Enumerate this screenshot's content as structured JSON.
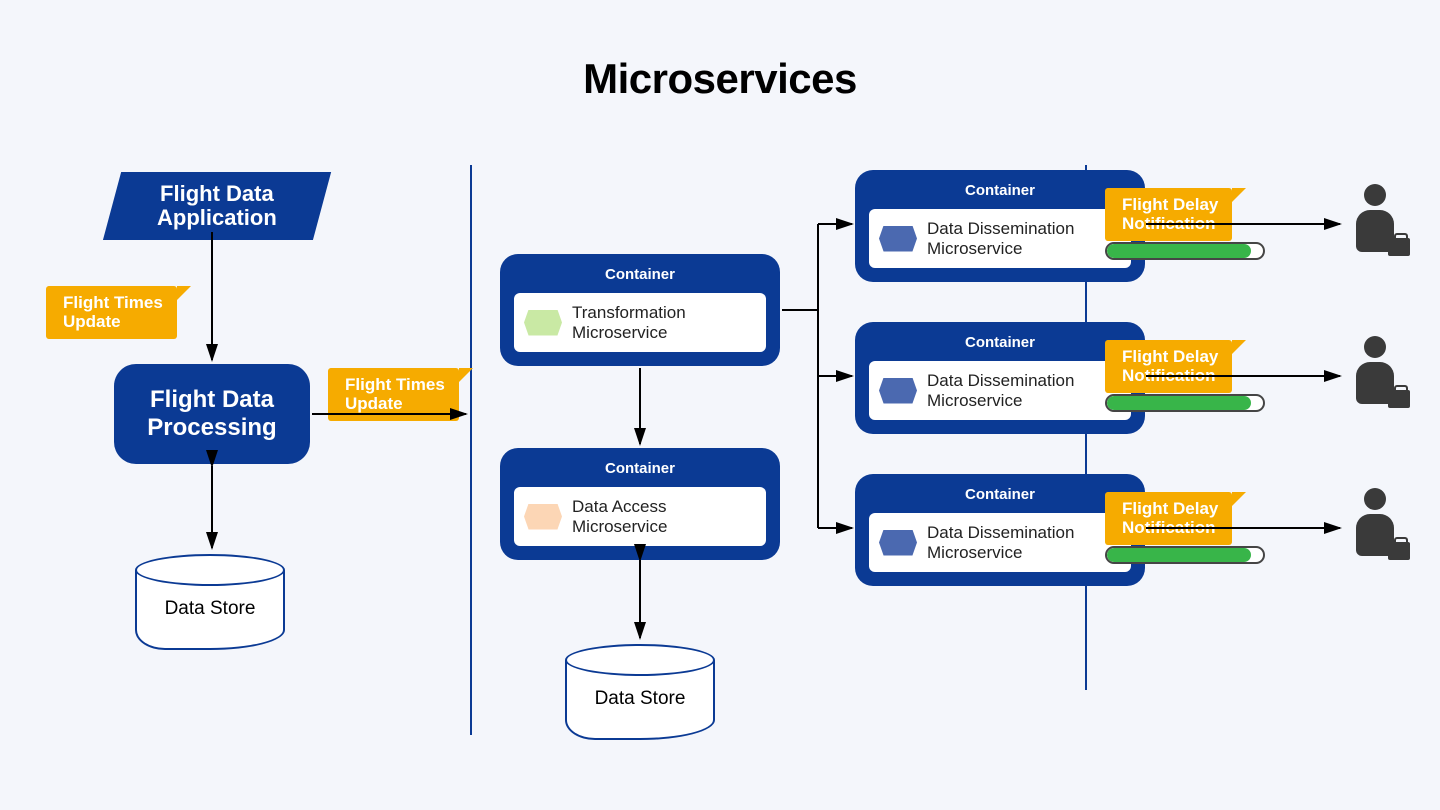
{
  "title": "Microservices",
  "left": {
    "application": "Flight Data\nApplication",
    "tag_update": "Flight Times\nUpdate",
    "processing": "Flight Data\nProcessing",
    "datastore": "Data Store"
  },
  "mid": {
    "tag_update": "Flight Times\nUpdate",
    "container_label": "Container",
    "transformation": "Transformation\nMicroservice",
    "data_access": "Data Access\nMicroservice",
    "datastore": "Data Store"
  },
  "right": {
    "container_label": "Container",
    "dissemination": "Data Dissemination\nMicroservice",
    "delay_notification": "Flight Delay\nNotification"
  },
  "colors": {
    "blue": "#0b3a94",
    "yellow": "#f6ab00",
    "green": "#38b549"
  }
}
